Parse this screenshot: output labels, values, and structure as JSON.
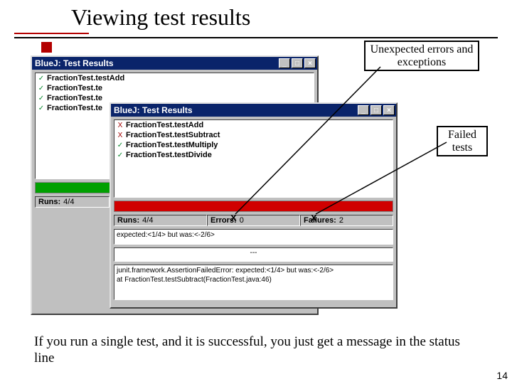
{
  "slide": {
    "title": "Viewing test results",
    "footer": "If you run a single test, and it is successful, you just get a message in the status line",
    "page_number": "14"
  },
  "callouts": {
    "errors_label": "Unexpected errors and exceptions",
    "failed_label": "Failed tests"
  },
  "window_a": {
    "title_app": "BlueJ:",
    "title_doc": "Test Results",
    "tests": [
      {
        "icon": "check",
        "name": "FractionTest.testAdd"
      },
      {
        "icon": "check",
        "name": "FractionTest.te"
      },
      {
        "icon": "check",
        "name": "FractionTest.te"
      },
      {
        "icon": "check",
        "name": "FractionTest.te"
      }
    ],
    "runs_label": "Runs:",
    "runs_value": "4/4"
  },
  "window_b": {
    "title_app": "BlueJ:",
    "title_doc": "Test Results",
    "tests": [
      {
        "icon": "x",
        "name": "FractionTest.testAdd"
      },
      {
        "icon": "x",
        "name": "FractionTest.testSubtract"
      },
      {
        "icon": "check",
        "name": "FractionTest.testMultiply"
      },
      {
        "icon": "check",
        "name": "FractionTest.testDivide"
      }
    ],
    "runs_label": "Runs:",
    "runs_value": "4/4",
    "errors_label": "Errors:",
    "errors_value": "0",
    "failures_label": "Failures:",
    "failures_value": "2",
    "detail1": "expected:<1/4> but was:<-2/6>",
    "detail_sep": "---",
    "detail2": "junit.framework.AssertionFailedError: expected:<1/4> but was:<-2/6>",
    "detail3": "   at FractionTest.testSubtract(FractionTest.java:46)"
  },
  "btn": {
    "min": "_",
    "max": "□",
    "close": "×"
  },
  "marks": {
    "x": "X"
  }
}
